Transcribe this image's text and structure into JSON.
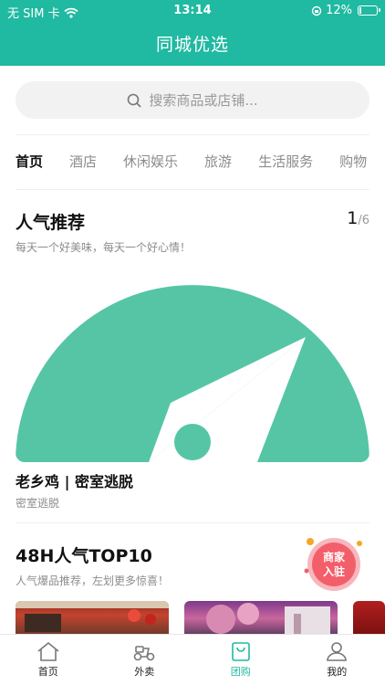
{
  "status_bar": {
    "carrier": "无 SIM 卡",
    "time": "13:14",
    "battery_text": "12%",
    "battery_level": 0.12
  },
  "header": {
    "title": "同城优选"
  },
  "search": {
    "placeholder": "搜索商品或店铺..."
  },
  "tabs": [
    {
      "label": "首页",
      "active": true
    },
    {
      "label": "酒店",
      "active": false
    },
    {
      "label": "休闲娱乐",
      "active": false
    },
    {
      "label": "旅游",
      "active": false
    },
    {
      "label": "生活服务",
      "active": false
    },
    {
      "label": "购物",
      "active": false
    }
  ],
  "popular": {
    "title": "人气推荐",
    "subtitle": "每天一个好美味，每天一个好心情！",
    "page_current": "1",
    "page_total": "/6",
    "item_title": "老乡鸡 | 密室逃脱",
    "item_subtitle": "密室逃脱"
  },
  "top10": {
    "title": "48H人气TOP10",
    "subtitle": "人气爆品推荐，左划更多惊喜！",
    "badge_text_1": "商家",
    "badge_text_2": "入驻"
  },
  "bottom_nav": [
    {
      "label": "首页",
      "icon": "home-icon",
      "active": false
    },
    {
      "label": "外卖",
      "icon": "scooter-icon",
      "active": false
    },
    {
      "label": "团购",
      "icon": "shopping-bag-icon",
      "active": true
    },
    {
      "label": "我的",
      "icon": "person-icon",
      "active": false
    }
  ],
  "colors": {
    "brand": "#20b9a1",
    "compass": "#55c5a6",
    "badge": "#f25f6a"
  }
}
